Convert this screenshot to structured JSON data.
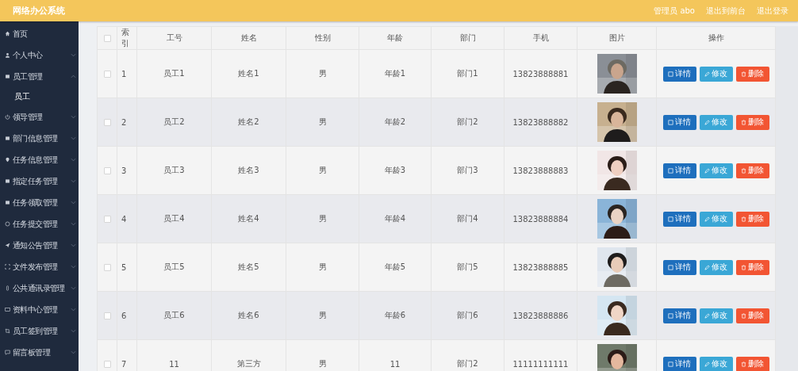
{
  "header": {
    "title": "网络办公系统",
    "links": [
      "管理员 abo",
      "退出到前台",
      "退出登录"
    ]
  },
  "sidebar": {
    "items": [
      {
        "label": "首页"
      },
      {
        "label": "个人中心",
        "expanded": false
      },
      {
        "label": "员工管理",
        "expanded": true,
        "children": [
          {
            "label": "员工"
          }
        ]
      },
      {
        "label": "领导管理",
        "expanded": false
      },
      {
        "label": "部门信息管理",
        "expanded": false
      },
      {
        "label": "任务信息管理",
        "expanded": false
      },
      {
        "label": "指定任务管理",
        "expanded": false
      },
      {
        "label": "任务领取管理",
        "expanded": false
      },
      {
        "label": "任务提交管理",
        "expanded": false
      },
      {
        "label": "通知公告管理",
        "expanded": false
      },
      {
        "label": "文件发布管理",
        "expanded": false
      },
      {
        "label": "公共通讯录管理",
        "expanded": false
      },
      {
        "label": "资料中心管理",
        "expanded": false
      },
      {
        "label": "员工签到管理",
        "expanded": false
      },
      {
        "label": "留言板管理",
        "expanded": false
      }
    ]
  },
  "table": {
    "header_checked": false,
    "columns": [
      "索引",
      "工号",
      "姓名",
      "性别",
      "年龄",
      "部门",
      "手机",
      "图片",
      "操作"
    ],
    "rows": [
      {
        "checked": false,
        "cells": [
          "1",
          "员工1",
          "姓名1",
          "男",
          "年龄1",
          "部门1",
          "13823888881"
        ],
        "actions": [
          "详情",
          "修改",
          "删除"
        ]
      },
      {
        "checked": false,
        "cells": [
          "2",
          "员工2",
          "姓名2",
          "男",
          "年龄2",
          "部门2",
          "13823888882"
        ],
        "actions": [
          "详情",
          "修改",
          "删除"
        ]
      },
      {
        "checked": false,
        "cells": [
          "3",
          "员工3",
          "姓名3",
          "男",
          "年龄3",
          "部门3",
          "13823888883"
        ],
        "actions": [
          "详情",
          "修改",
          "删除"
        ]
      },
      {
        "checked": false,
        "cells": [
          "4",
          "员工4",
          "姓名4",
          "男",
          "年龄4",
          "部门4",
          "13823888884"
        ],
        "actions": [
          "详情",
          "修改",
          "删除"
        ]
      },
      {
        "checked": false,
        "cells": [
          "5",
          "员工5",
          "姓名5",
          "男",
          "年龄5",
          "部门5",
          "13823888885"
        ],
        "actions": [
          "详情",
          "修改",
          "删除"
        ]
      },
      {
        "checked": false,
        "cells": [
          "6",
          "员工6",
          "姓名6",
          "男",
          "年龄6",
          "部门6",
          "13823888886"
        ],
        "actions": [
          "详情",
          "修改",
          "删除"
        ]
      },
      {
        "checked": false,
        "cells": [
          "7",
          "11",
          "第三方",
          "男",
          "11",
          "部门2",
          "11111111111"
        ],
        "actions": [
          "详情",
          "修改",
          "删除"
        ]
      }
    ]
  }
}
